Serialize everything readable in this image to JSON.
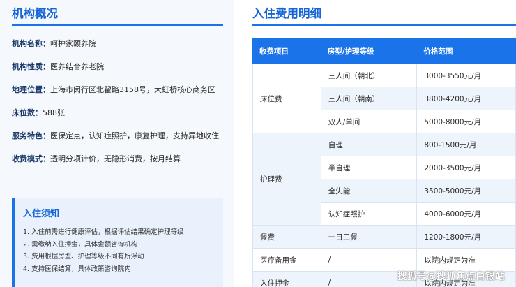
{
  "overview": {
    "title": "机构概况",
    "rows": [
      {
        "label": "机构名称：",
        "value": "呵护家颐养院"
      },
      {
        "label": "机构性质：",
        "value": "医养结合养老院"
      },
      {
        "label": "地理位置：",
        "value": "上海市闵行区北翟路3158号，大虹桥核心商务区"
      },
      {
        "label": "床位数：",
        "value": "588张"
      },
      {
        "label": "服务特色：",
        "value": "医保定点，认知症照护，康复护理，支持异地收住"
      },
      {
        "label": "收费模式：",
        "value": "透明分项计价，无隐形消费，按月结算"
      }
    ]
  },
  "notice": {
    "title": "入住须知",
    "items": [
      "1. 入住前需进行健康评估，根据评估结果确定护理等级",
      "2. 需缴纳入住押金，具体金额咨询机构",
      "3. 费用根据房型、护理等级不同有所浮动",
      "4. 支持医保结算，具体政策咨询院内"
    ]
  },
  "fees": {
    "title": "入住费用明细",
    "headers": [
      "收费项目",
      "房型/护理等级",
      "价格范围"
    ],
    "groups": {
      "bed": {
        "name": "床位费",
        "rows": [
          {
            "type": "三人间（朝北）",
            "price": "3000-3550元/月"
          },
          {
            "type": "三人间（朝南）",
            "price": "3800-4200元/月"
          },
          {
            "type": "双人/单间",
            "price": "5000-8000元/月"
          }
        ]
      },
      "care": {
        "name": "护理费",
        "rows": [
          {
            "type": "自理",
            "price": "800-1500元/月"
          },
          {
            "type": "半自理",
            "price": "2000-3500元/月"
          },
          {
            "type": "全失能",
            "price": "3500-5000元/月"
          },
          {
            "type": "认知症照护",
            "price": "4000-6000元/月"
          }
        ]
      },
      "meal": {
        "name": "餐费",
        "type": "一日三餐",
        "price": "1200-1800元/月"
      },
      "medical": {
        "name": "医疗备用金",
        "type": "/",
        "price": "以院内规定为准"
      },
      "deposit": {
        "name": "入住押金",
        "type": "/",
        "price": "以院内规定为准"
      }
    }
  },
  "watermark": "搜狐号@搜狐焦点白银站"
}
